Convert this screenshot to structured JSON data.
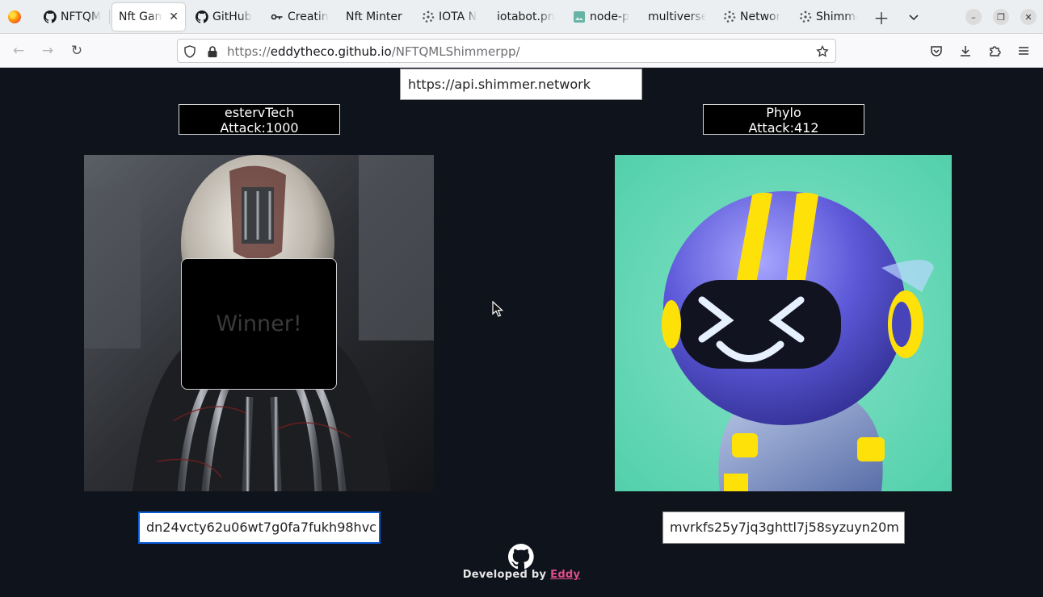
{
  "browser": {
    "tabs": [
      {
        "label": "NFTQM",
        "icon": "github-icon"
      },
      {
        "label": "Nft Gam",
        "icon": "none",
        "active": true
      },
      {
        "label": "GitHub",
        "icon": "github-icon"
      },
      {
        "label": "Creatin",
        "icon": "git-icon"
      },
      {
        "label": "Nft Minter",
        "icon": "none"
      },
      {
        "label": "IOTA N",
        "icon": "iota-icon"
      },
      {
        "label": "iotabot.pn",
        "icon": "none"
      },
      {
        "label": "node-p",
        "icon": "image-icon"
      },
      {
        "label": "multiverse",
        "icon": "none"
      },
      {
        "label": "Networ",
        "icon": "iota-icon"
      },
      {
        "label": "Shimme",
        "icon": "iota-icon"
      }
    ],
    "url_prefix": "https://",
    "url_host": "eddytheco.github.io",
    "url_path": "/NFTQMLShimmerpp/"
  },
  "page": {
    "node_url": "https://api.shimmer.network",
    "left_player": {
      "name": "estervTech",
      "attack": "Attack:1000",
      "address": "dn24vcty62u06wt7g0fa7fukh98hvc",
      "overlay": "Winner!"
    },
    "right_player": {
      "name": "Phylo",
      "attack": "Attack:412",
      "address": "mvrkfs25y7jq3ghttl7j58syzuyn20m"
    },
    "footer": {
      "prefix": "Developed by",
      "author": "Eddy"
    }
  },
  "colors": {
    "page_bg": "#0f141c",
    "focus_border": "#0a5bd8",
    "author_link": "#e04d8a"
  }
}
